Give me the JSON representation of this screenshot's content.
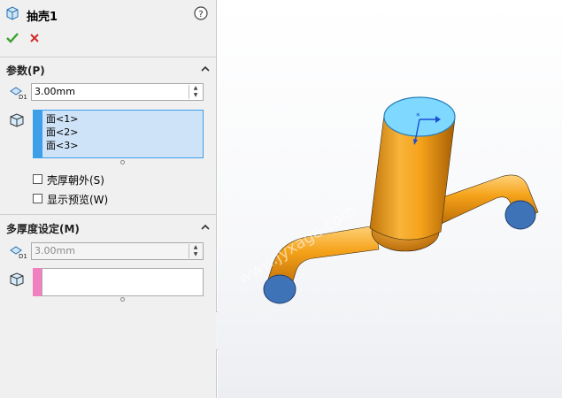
{
  "header": {
    "title": "抽壳1",
    "help_icon": "question-circle-icon",
    "ok_icon": "checkmark-icon",
    "cancel_icon": "x-icon"
  },
  "params": {
    "section_title": "参数(P)",
    "thickness_value": "3.00mm",
    "faces": [
      "面<1>",
      "面<2>",
      "面<3>"
    ],
    "shell_outward_label": "壳厚朝外(S)",
    "show_preview_label": "显示预览(W)",
    "shell_outward_checked": false,
    "show_preview_checked": false
  },
  "multi": {
    "section_title": "多厚度设定(M)",
    "thickness_value": "3.00mm"
  },
  "colors": {
    "accent_blue": "#3c9fe8",
    "pink": "#f080c0",
    "part_orange": "#f5a21a",
    "face_cyan": "#7fd8ff",
    "cap_blue": "#3f73b8"
  },
  "watermark": "www.jyxage.com"
}
